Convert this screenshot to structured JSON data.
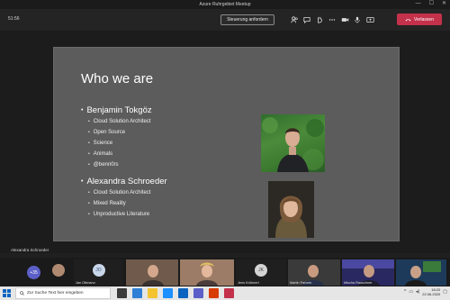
{
  "window": {
    "title": "Azure Ruhrgebiet Meetup",
    "minimize": "—",
    "maximize": "☐",
    "close": "✕"
  },
  "toolbar": {
    "timer": "51:56",
    "control_request_label": "Steuerung anfordern",
    "leave_label": "Verlassen"
  },
  "slide": {
    "title": "Who we are",
    "people": [
      {
        "name": "Benjamin Tokgöz",
        "items": [
          "Cloud Solution Architect",
          "Open Source",
          "Science",
          "Animals",
          "@benn0rs"
        ]
      },
      {
        "name": "Alexandra Schroeder",
        "items": [
          "Cloud Solution Architect",
          "Mixed Reality",
          "Unproductive Literature"
        ]
      }
    ]
  },
  "presenter": "Alexandra Schroeder",
  "participants": {
    "more_count": "+35",
    "tiles": [
      {
        "name": "",
        "initials": "",
        "color": "#6b5a4a"
      },
      {
        "name": "Jan Ottmann",
        "initials": "JO",
        "color": "#c9d7ea"
      },
      {
        "name": "",
        "initials": "",
        "color": "#7a5e50"
      },
      {
        "name": "",
        "initials": "",
        "color": "#8a6a5a"
      },
      {
        "name": "Jens Krühnert",
        "initials": "JK",
        "color": "#d4d4d4"
      },
      {
        "name": "Martin Parizek",
        "initials": "",
        "color": "#3a3a3a"
      },
      {
        "name": "Mischa Rauschner",
        "initials": "",
        "color": "#3c3a7a"
      },
      {
        "name": "",
        "initials": "",
        "color": "#2e4a6a"
      }
    ]
  },
  "taskbar": {
    "search_placeholder": "Zur Suche Text hier eingeben",
    "time": "18:20",
    "date": "22.06.2020",
    "apps": [
      "#3b3b3b",
      "#2f7fd6",
      "#f4c430",
      "#1e90ff",
      "#0a64c0",
      "#5b5fc7",
      "#d83b01",
      "#c4314b"
    ]
  },
  "colors": {
    "accent": "#5b5fc7",
    "leave": "#c4314b",
    "slide_bg": "#5c5c5c"
  }
}
